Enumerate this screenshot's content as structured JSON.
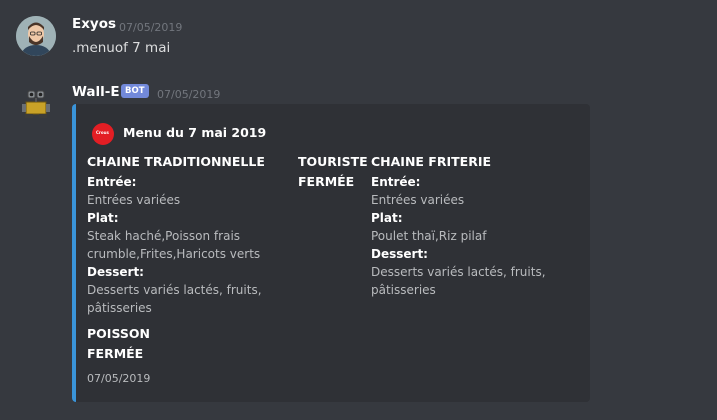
{
  "messages": [
    {
      "author": "Exyos",
      "timestamp": "07/05/2019",
      "text": ".menuof 7 mai"
    },
    {
      "author": "Wall-E",
      "badge": "BOT",
      "timestamp": "07/05/2019"
    }
  ],
  "embed": {
    "accent_color": "#3a94d9",
    "title": "Menu du 7 mai 2019",
    "icon_text": "Crous",
    "footer": "07/05/2019",
    "traditional": {
      "heading": "CHAINE TRADITIONNELLE",
      "entree_label": "Entrée:",
      "entree": "Entrées variées",
      "plat_label": "Plat:",
      "plat_line1": "Steak haché,Poisson frais",
      "plat_line2": "crumble,Frites,Haricots verts",
      "dessert_label": "Dessert:",
      "dessert_line1": "Desserts variés lactés, fruits,",
      "dessert_line2": "pâtisseries"
    },
    "touriste": {
      "heading": "TOURISTE",
      "status": "FERMÉE"
    },
    "friterie": {
      "heading": "CHAINE FRITERIE",
      "entree_label": "Entrée:",
      "entree": "Entrées variées",
      "plat_label": "Plat:",
      "plat": "Poulet thaï,Riz pilaf",
      "dessert_label": "Dessert:",
      "dessert_line1": "Desserts variés lactés, fruits,",
      "dessert_line2": "pâtisseries"
    },
    "poisson": {
      "heading": "POISSON",
      "status": "FERMÉE"
    }
  }
}
